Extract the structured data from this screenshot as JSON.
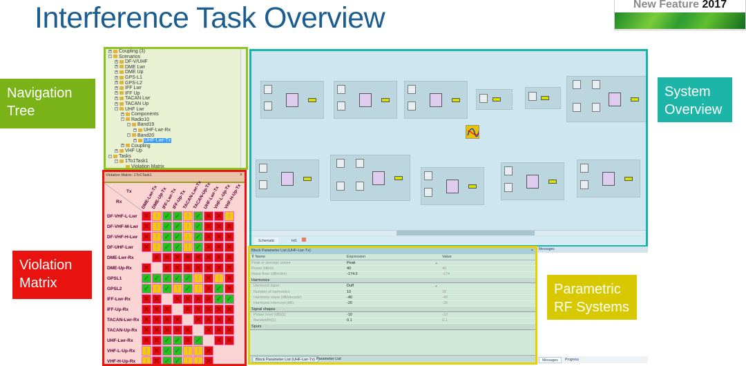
{
  "slide": {
    "title": "Interference Task Overview",
    "badge": {
      "text": "New Feature",
      "year": "2017"
    },
    "callouts": {
      "navigation_tree": "Navigation Tree",
      "violation_matrix": "Violation Matrix",
      "system_overview": "System Overview",
      "parametric_rf": "Parametric RF Systems"
    },
    "colors": {
      "title": "#1b5d8f",
      "nav": "#7ab317",
      "violation": "#e8120f",
      "system": "#1cb5a8",
      "parametric": "#d8c800"
    }
  },
  "tree": {
    "items": [
      {
        "label": "Coupling (3)",
        "level": 0,
        "expand": "+"
      },
      {
        "label": "Scenarios",
        "level": 0,
        "expand": "-"
      },
      {
        "label": "DF-V/UHF",
        "level": 1,
        "expand": "+"
      },
      {
        "label": "DME Lwr",
        "level": 1,
        "expand": "+"
      },
      {
        "label": "DME Up",
        "level": 1,
        "expand": "+"
      },
      {
        "label": "GPS-L1",
        "level": 1,
        "expand": "+"
      },
      {
        "label": "GPS-L2",
        "level": 1,
        "expand": "+"
      },
      {
        "label": "IFF Lwr",
        "level": 1,
        "expand": "+"
      },
      {
        "label": "IFF Up",
        "level": 1,
        "expand": "+"
      },
      {
        "label": "TACAN Lwr",
        "level": 1,
        "expand": "+"
      },
      {
        "label": "TACAN Up",
        "level": 1,
        "expand": "+"
      },
      {
        "label": "UHF Lwr",
        "level": 1,
        "expand": "-"
      },
      {
        "label": "Components",
        "level": 2,
        "expand": "+"
      },
      {
        "label": "Radio10",
        "level": 2,
        "expand": "-"
      },
      {
        "label": "Band19",
        "level": 3,
        "expand": "-"
      },
      {
        "label": "UHF-Lwr-Rx",
        "level": 4,
        "expand": "+"
      },
      {
        "label": "Band20",
        "level": 3,
        "expand": "-"
      },
      {
        "label": "UHF-Lwr-Tx",
        "level": 4,
        "expand": "+",
        "selected": true
      },
      {
        "label": "Coupling",
        "level": 2,
        "expand": "+"
      },
      {
        "label": "VHF Up",
        "level": 1,
        "expand": "+"
      },
      {
        "label": "Tasks",
        "level": 0,
        "expand": "-"
      },
      {
        "label": "1To1Task1",
        "level": 1,
        "expand": "-"
      },
      {
        "label": "Violation Matrix",
        "level": 2,
        "expand": ""
      }
    ]
  },
  "matrix": {
    "title": "Violation Matrix: 1To1Task1",
    "tx_label": "Tx",
    "rx_label": "Rx",
    "columns": [
      "DME-Lwr-Tx",
      "DME-Up-Tx",
      "IFF-Lwr-Tx",
      "IFF-Up-Tx",
      "TACAN-Lwr-Tx",
      "TACAN-Up-Tx",
      "UHF-Lwr-Tx",
      "VHF-L-Up-Tx",
      "VHF-H-Up-Tx"
    ],
    "rows": [
      {
        "label": "DF-VHF-L-Lwr",
        "cells": [
          "X",
          "W",
          "V",
          "V",
          "W",
          "V",
          "X",
          "X",
          "W"
        ]
      },
      {
        "label": "DF-VHF-M-Lwr",
        "cells": [
          "X",
          "W",
          "V",
          "V",
          "W",
          "V",
          "X",
          "X",
          "X"
        ]
      },
      {
        "label": "DF-VHF-H-Lwr",
        "cells": [
          "X",
          "W",
          "V",
          "V",
          "W",
          "V",
          "X",
          "X",
          "X"
        ]
      },
      {
        "label": "DF-UHF-Lwr",
        "cells": [
          "X",
          "W",
          "V",
          "V",
          "W",
          "V",
          "X",
          "X",
          "X"
        ]
      },
      {
        "label": "DME-Lwr-Rx",
        "cells": [
          "E",
          "X",
          "X",
          "X",
          "X",
          "X",
          "X",
          "X",
          "X"
        ]
      },
      {
        "label": "DME-Up-Rx",
        "cells": [
          "X",
          "E",
          "X",
          "X",
          "X",
          "X",
          "X",
          "X",
          "X"
        ]
      },
      {
        "label": "GPSL1",
        "cells": [
          "V",
          "V",
          "V",
          "V",
          "V",
          "W",
          "X",
          "W",
          "X"
        ]
      },
      {
        "label": "GPSL2",
        "cells": [
          "V",
          "W",
          "V",
          "W",
          "V",
          "W",
          "X",
          "V",
          "X"
        ]
      },
      {
        "label": "IFF-Lwr-Rx",
        "cells": [
          "X",
          "X",
          "E",
          "X",
          "X",
          "X",
          "X",
          "V",
          "V"
        ]
      },
      {
        "label": "IFF-Up-Rx",
        "cells": [
          "X",
          "X",
          "X",
          "E",
          "X",
          "X",
          "X",
          "X",
          "X"
        ]
      },
      {
        "label": "TACAN-Lwr-Rx",
        "cells": [
          "X",
          "X",
          "X",
          "X",
          "E",
          "X",
          "X",
          "X",
          "X"
        ]
      },
      {
        "label": "TACAN-Up-Rx",
        "cells": [
          "X",
          "X",
          "X",
          "X",
          "X",
          "E",
          "X",
          "X",
          "X"
        ]
      },
      {
        "label": "UHF-Lwr-Rx",
        "cells": [
          "X",
          "X",
          "V",
          "V",
          "X",
          "V",
          "E",
          "X",
          "X"
        ]
      },
      {
        "label": "VHF-L-Up-Rx",
        "cells": [
          "W",
          "X",
          "V",
          "V",
          "W",
          "W",
          "X",
          "E",
          "E"
        ]
      },
      {
        "label": "VHF-H-Up-Rx",
        "cells": [
          "W",
          "X",
          "V",
          "V",
          "W",
          "W",
          "X",
          "E",
          "E"
        ]
      }
    ],
    "legend_colors": {
      "X": "#e01010",
      "W": "#f5c810",
      "V": "#28c020"
    }
  },
  "system": {
    "tabs": [
      "Schematic",
      "txt1"
    ]
  },
  "params": {
    "title": "Block Parameter List (UHF-Lwr-Tx)",
    "headers": [
      "Name",
      "Expression",
      "Value"
    ],
    "rows": [
      {
        "name": "Peak or average power",
        "expr": "Peak",
        "value": "",
        "dropdown": true
      },
      {
        "name": "Power (dBm)",
        "expr": "40",
        "value": "40"
      },
      {
        "name": "Noise floor (dBm/Hz)",
        "expr": "-174.0",
        "value": "-174"
      },
      {
        "group": "Harmonics"
      },
      {
        "name": "Harmonic taper",
        "expr": "Duff",
        "value": "",
        "dropdown": true,
        "indent": true
      },
      {
        "name": "Number of harmonics",
        "expr": "10",
        "value": "10",
        "indent": true
      },
      {
        "name": "Harmonic slope (dB/decade)",
        "expr": "-40",
        "value": "-40",
        "indent": true
      },
      {
        "name": "Harmonic intercept (dB)",
        "expr": "-20",
        "value": "-20",
        "indent": true
      },
      {
        "group": "Signal shapes"
      },
      {
        "name": "Power level (dB)[1]",
        "expr": "-10",
        "value": "-10",
        "indent": true
      },
      {
        "name": "Bandwidth[1]",
        "expr": "0.1",
        "value": "0.1",
        "indent": true
      },
      {
        "group": "Spurs"
      }
    ],
    "tabs": [
      "Block Parameter List (UHF-Lwr-Tx)",
      "Parameter List"
    ]
  },
  "messages": {
    "title": "Messages",
    "tabs": [
      "Messages",
      "Progress"
    ]
  }
}
